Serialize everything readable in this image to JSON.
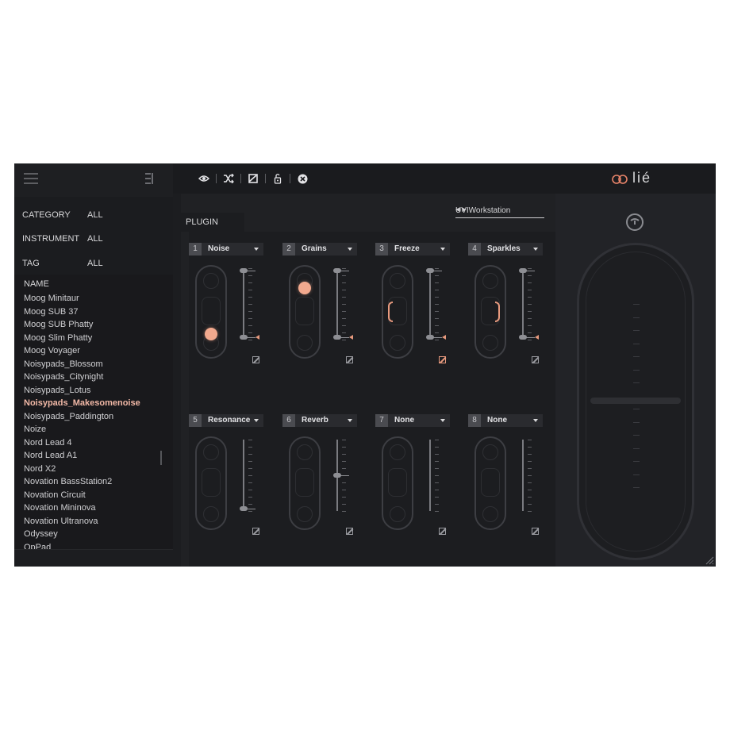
{
  "sidebar": {
    "filters": [
      {
        "label": "CATEGORY",
        "value": "ALL"
      },
      {
        "label": "INSTRUMENT",
        "value": "ALL"
      },
      {
        "label": "TAG",
        "value": "ALL"
      }
    ],
    "list_header": "NAME",
    "items": [
      "Moog Minitaur",
      "Moog SUB 37",
      "Moog SUB Phatty",
      "Moog Slim Phatty",
      "Moog Voyager",
      "Noisypads_Blossom",
      "Noisypads_Citynight",
      "Noisypads_Lotus",
      "Noisypads_Makesomenoise",
      "Noisypads_Paddington",
      "Noize",
      "Nord Lead 4",
      "Nord Lead A1",
      "Nord X2",
      "Novation BassStation2",
      "Novation Circuit",
      "Novation Mininova",
      "Novation Ultranova",
      "Odyssey",
      "OpPad"
    ],
    "selected_item": "Noisypads_Makesomenoise"
  },
  "toolbar": {
    "icons": [
      "eye-icon",
      "shuffle-icon",
      "edit-box-icon",
      "lock-icon",
      "close-circle-icon"
    ]
  },
  "logo": {
    "text": "lié",
    "accent": "#e8846a"
  },
  "main": {
    "plugin_tab": "PLUGIN",
    "preset_name": "UVIWorkstation",
    "slots": [
      {
        "num": "1",
        "name": "Noise",
        "mode": "dot",
        "dot_level": 0.15,
        "slider_level": 1.0,
        "enabled": false
      },
      {
        "num": "2",
        "name": "Grains",
        "mode": "dot",
        "dot_level": 0.85,
        "slider_level": 1.0,
        "enabled": false
      },
      {
        "num": "3",
        "name": "Freeze",
        "mode": "bracket-left",
        "slider_level": 1.0,
        "enabled": true
      },
      {
        "num": "4",
        "name": "Sparkles",
        "mode": "bracket-right",
        "slider_level": 1.0,
        "enabled": false
      },
      {
        "num": "5",
        "name": "Resonance",
        "mode": "none",
        "slider_level": 0.0,
        "enabled": false
      },
      {
        "num": "6",
        "name": "Reverb",
        "mode": "none",
        "slider_level": 0.5,
        "enabled": false
      },
      {
        "num": "7",
        "name": "None",
        "mode": "none",
        "enabled": false
      },
      {
        "num": "8",
        "name": "None",
        "mode": "none",
        "enabled": false
      }
    ]
  },
  "colors": {
    "accent": "#e89a7e",
    "background": "#1c1d20"
  }
}
